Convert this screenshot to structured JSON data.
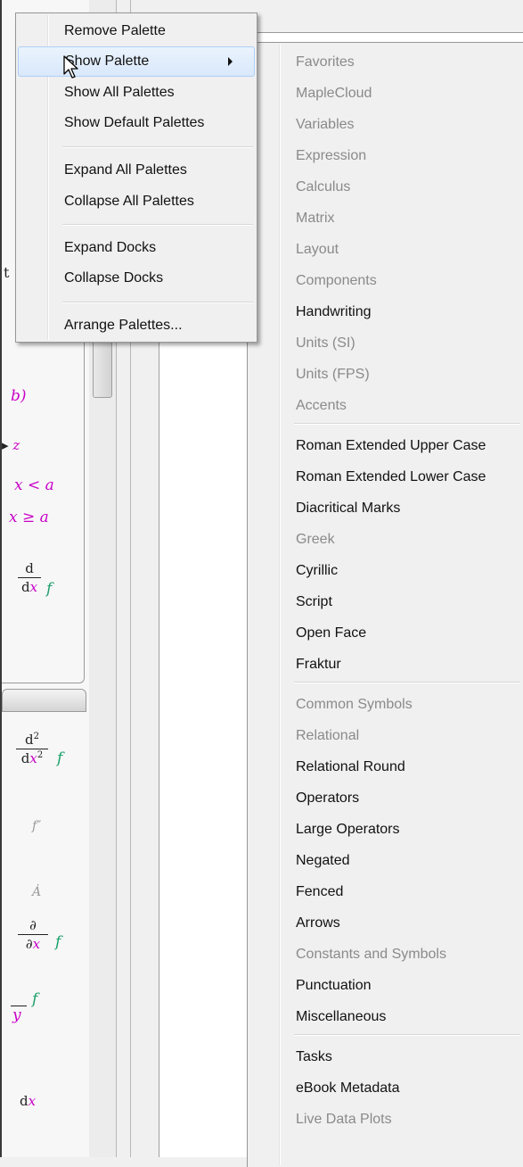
{
  "main_menu": {
    "items": [
      {
        "label": "Remove Palette",
        "state": "enabled"
      },
      {
        "label": "Show Palette",
        "state": "hover",
        "has_submenu": true
      },
      {
        "label": "Show All Palettes",
        "state": "enabled"
      },
      {
        "label": "Show Default Palettes",
        "state": "enabled"
      },
      {
        "label": "Expand All Palettes",
        "state": "enabled"
      },
      {
        "label": "Collapse All Palettes",
        "state": "enabled"
      },
      {
        "label": "Expand Docks",
        "state": "enabled"
      },
      {
        "label": "Collapse Docks",
        "state": "enabled"
      },
      {
        "label": "Arrange Palettes...",
        "state": "enabled"
      }
    ]
  },
  "submenu": {
    "items": [
      {
        "label": "Favorites",
        "enabled": false
      },
      {
        "label": "MapleCloud",
        "enabled": false
      },
      {
        "label": "Variables",
        "enabled": false
      },
      {
        "label": "Expression",
        "enabled": false
      },
      {
        "label": "Calculus",
        "enabled": false
      },
      {
        "label": "Matrix",
        "enabled": false
      },
      {
        "label": "Layout",
        "enabled": false
      },
      {
        "label": "Components",
        "enabled": false
      },
      {
        "label": "Handwriting",
        "enabled": true
      },
      {
        "label": "Units (SI)",
        "enabled": false
      },
      {
        "label": "Units (FPS)",
        "enabled": false
      },
      {
        "label": "Accents",
        "enabled": false
      },
      {
        "label": "Roman Extended Upper Case",
        "enabled": true
      },
      {
        "label": "Roman Extended Lower Case",
        "enabled": true
      },
      {
        "label": "Diacritical Marks",
        "enabled": true
      },
      {
        "label": "Greek",
        "enabled": false
      },
      {
        "label": "Cyrillic",
        "enabled": true
      },
      {
        "label": "Script",
        "enabled": true
      },
      {
        "label": "Open Face",
        "enabled": true
      },
      {
        "label": "Fraktur",
        "enabled": true
      },
      {
        "label": "Common Symbols",
        "enabled": false
      },
      {
        "label": "Relational",
        "enabled": false
      },
      {
        "label": "Relational Round",
        "enabled": true
      },
      {
        "label": "Operators",
        "enabled": true
      },
      {
        "label": "Large Operators",
        "enabled": true
      },
      {
        "label": "Negated",
        "enabled": true
      },
      {
        "label": "Fenced",
        "enabled": true
      },
      {
        "label": "Arrows",
        "enabled": true
      },
      {
        "label": "Constants and Symbols",
        "enabled": false
      },
      {
        "label": "Punctuation",
        "enabled": true
      },
      {
        "label": "Miscellaneous",
        "enabled": true
      },
      {
        "label": "Tasks",
        "enabled": true
      },
      {
        "label": "eBook Metadata",
        "enabled": true
      },
      {
        "label": "Live Data Plots",
        "enabled": false
      }
    ]
  },
  "palette_fragments": {
    "b_paren": "b)",
    "arrow_z": "z",
    "x_lt_a": "x < a",
    "x_ge_a": "x ≥ a",
    "d_num": "d",
    "dx_den_d": "d",
    "dx_den_x": "x",
    "f1": "f",
    "d2_num": "d",
    "d2_den_d": "d",
    "d2_den_x": "x",
    "f2": "f",
    "f_dprime": "f″",
    "a_dot": "Ȧ",
    "partial_num": "∂",
    "partial_den_d": "∂",
    "partial_den_x": "x",
    "f3": "f",
    "y_bar": "y",
    "f4": "f",
    "dx_d": "d",
    "dx_x": "x",
    "edge_t": "t"
  },
  "colors": {
    "menu_bg": "#f0f0f0",
    "hover_bg": "#d9e8fb",
    "hover_border": "#aecff7",
    "disabled_text": "#8a8a8a",
    "math_magenta": "#c800c8",
    "math_green": "#1aa06a"
  }
}
